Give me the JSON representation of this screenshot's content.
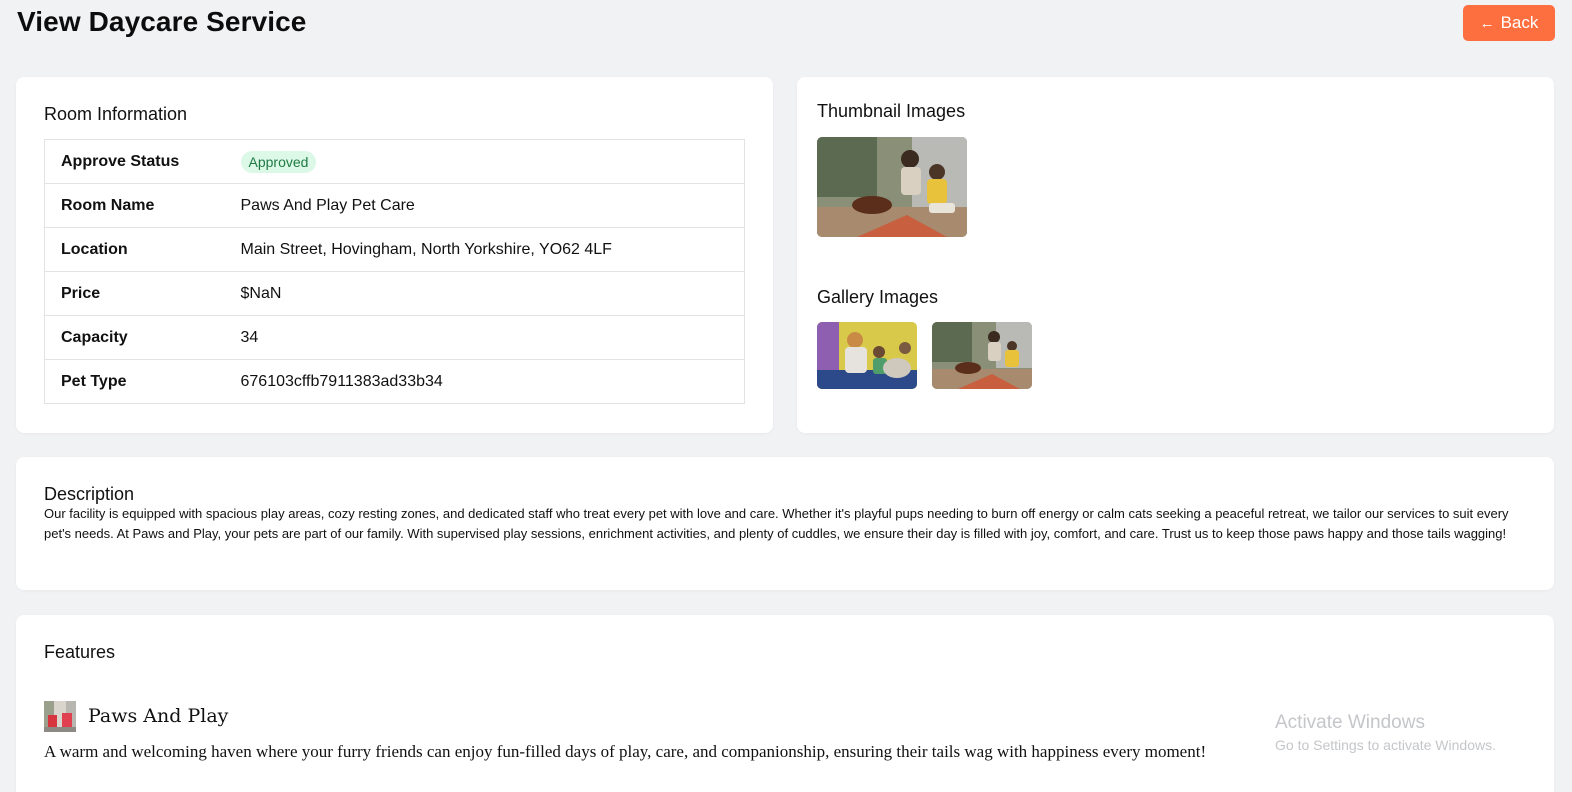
{
  "header": {
    "title": "View Daycare Service",
    "back_label": "Back"
  },
  "room_info": {
    "title": "Room Information",
    "rows": [
      {
        "label": "Approve Status",
        "value": "Approved",
        "badge": true
      },
      {
        "label": "Room Name",
        "value": "Paws And Play Pet Care"
      },
      {
        "label": "Location",
        "value": "Main Street, Hovingham, North Yorkshire, YO62 4LF"
      },
      {
        "label": "Price",
        "value": "$NaN"
      },
      {
        "label": "Capacity",
        "value": "34"
      },
      {
        "label": "Pet Type",
        "value": "676103cffb7911383ad33b34"
      }
    ]
  },
  "images": {
    "thumbnail_title": "Thumbnail Images",
    "gallery_title": "Gallery Images"
  },
  "description": {
    "title": "Description",
    "text": "Our facility is equipped with spacious play areas, cozy resting zones, and dedicated staff who treat every pet with love and care. Whether it's playful pups needing to burn off energy or calm cats seeking a peaceful retreat, we tailor our services to suit every pet's needs. At Paws and Play, your pets are part of our family. With supervised play sessions, enrichment activities, and plenty of cuddles, we ensure their day is filled with joy, comfort, and care. Trust us to keep those paws happy and those tails wagging!"
  },
  "features": {
    "title": "Features",
    "items": [
      {
        "name": "Paws And Play",
        "description": "A warm and welcoming haven where your furry friends can enjoy fun-filled days of play, care, and companionship, ensuring their tails wag with happiness every moment!"
      }
    ]
  },
  "watermark": {
    "line1": "Activate Windows",
    "line2": "Go to Settings to activate Windows."
  },
  "colors": {
    "accent": "#fe6f3f",
    "background": "#f1f2f4",
    "badge_bg": "#dcf8e6",
    "badge_text": "#1f7a44"
  }
}
